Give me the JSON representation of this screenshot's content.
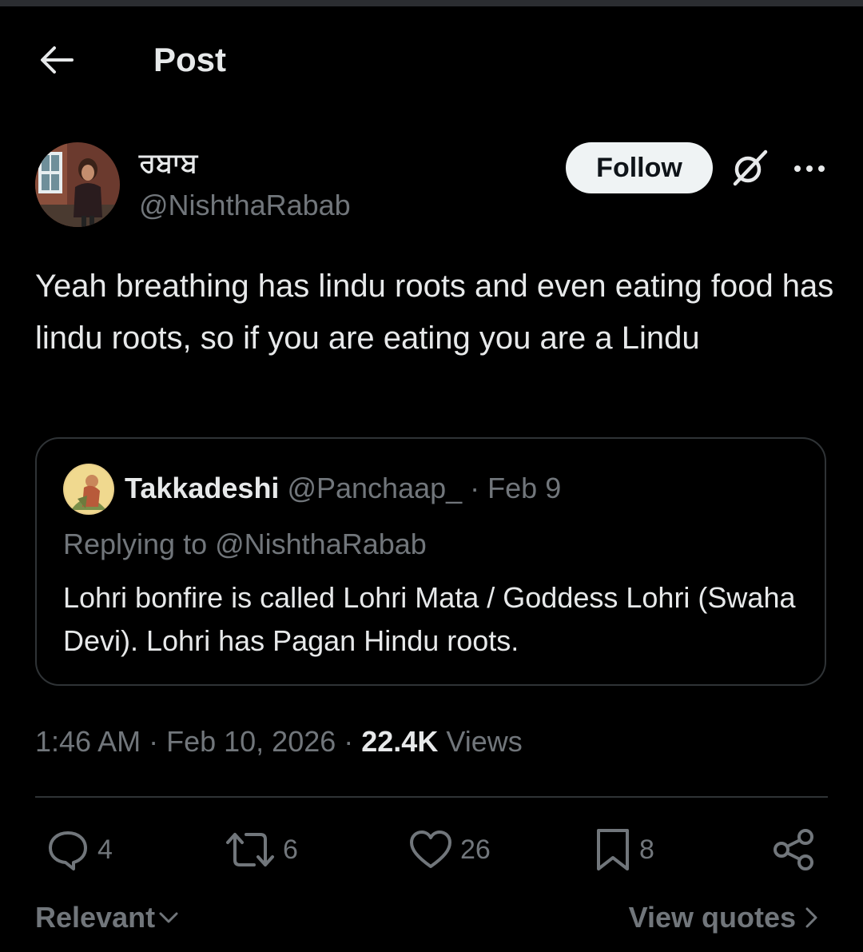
{
  "header": {
    "back_icon": "arrow-left-icon",
    "title": "Post"
  },
  "author": {
    "display_name": "ਰਬਾਬ",
    "handle": "@NishthaRabab",
    "follow_label": "Follow",
    "grok_icon": "grok-icon",
    "more_icon": "more-dots-icon"
  },
  "tweet": {
    "text": "Yeah breathing has lindu roots and even eating food has lindu roots, so if you are eating you are a Lindu"
  },
  "quote": {
    "name": "Takkadeshi",
    "handle": "@Panchaap_",
    "separator": " · ",
    "date": "Feb 9",
    "replying_to": "Replying to @NishthaRabab",
    "text": "Lohri bonfire is called Lohri Mata / Goddess Lohri (Swaha Devi). Lohri has Pagan Hindu roots."
  },
  "meta": {
    "time": "1:46 AM",
    "sep1": " · ",
    "date": "Feb 10, 2026",
    "sep2": " · ",
    "views_count": "22.4K",
    "views_label": "Views"
  },
  "actions": {
    "replies": "4",
    "reposts": "6",
    "likes": "26",
    "bookmarks": "8"
  },
  "footer": {
    "sort_label": "Relevant",
    "view_quotes_label": "View quotes"
  },
  "colors": {
    "background": "#000000",
    "text_primary": "#e7e9ea",
    "text_muted": "#71767b",
    "border": "#2f3336",
    "follow_bg": "#eff3f4"
  }
}
